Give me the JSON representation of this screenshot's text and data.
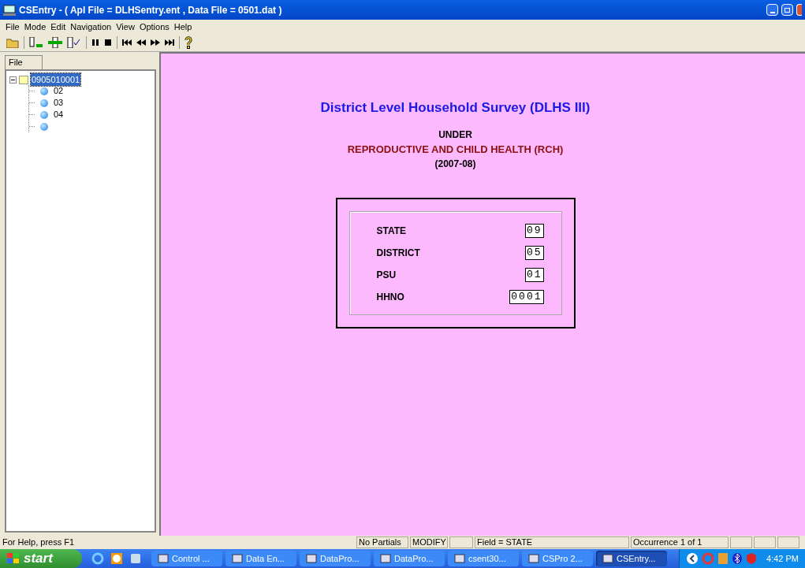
{
  "window": {
    "title": "CSEntry - ( Apl File = DLHSentry.ent , Data File = 0501.dat )"
  },
  "menu": [
    "File",
    "Mode",
    "Edit",
    "Navigation",
    "View",
    "Options",
    "Help"
  ],
  "sidebar": {
    "tab": "File",
    "tree": {
      "label": "0905010001",
      "selected": true,
      "expanded": true,
      "children": [
        {
          "kind": "record",
          "label": "02"
        },
        {
          "kind": "record",
          "label": "03"
        },
        {
          "kind": "record",
          "label": "04"
        },
        {
          "kind": "record"
        }
      ]
    }
  },
  "form": {
    "heading": [
      {
        "kind": "title",
        "text": "District Level Household Survey (DLHS III)"
      },
      {
        "kind": "note",
        "text": "UNDER"
      },
      {
        "kind": "program",
        "text": "REPRODUCTIVE AND CHILD HEALTH (RCH)"
      },
      {
        "kind": "note",
        "text": "(2007-08)"
      }
    ],
    "fields": [
      {
        "label": "STATE",
        "value": "09"
      },
      {
        "label": "DISTRICT",
        "value": "05"
      },
      {
        "label": "PSU",
        "value": "01"
      },
      {
        "label": "HHNO",
        "value": "0001"
      }
    ]
  },
  "status_bar": [
    {
      "kind": "text",
      "text": "For Help, press F1"
    },
    {
      "kind": "text",
      "text": "No Partials"
    },
    {
      "kind": "text",
      "text": "MODIFY"
    },
    {
      "kind": "blank"
    },
    {
      "kind": "text",
      "text": "Field = STATE"
    },
    {
      "kind": "text",
      "text": "Occurrence 1 of 1"
    }
  ],
  "taskbar": {
    "start": "start",
    "items": [
      {
        "label": "Control ...",
        "selected": false
      },
      {
        "label": "Data En...",
        "selected": false
      },
      {
        "label": "DataPro...",
        "selected": false
      },
      {
        "label": "DataPro...",
        "selected": false
      },
      {
        "label": "csent30...",
        "selected": false
      },
      {
        "label": "CSPro 2...",
        "selected": false
      },
      {
        "label": "CSEntry...",
        "selected": true
      }
    ],
    "clock": "4:42 PM"
  }
}
